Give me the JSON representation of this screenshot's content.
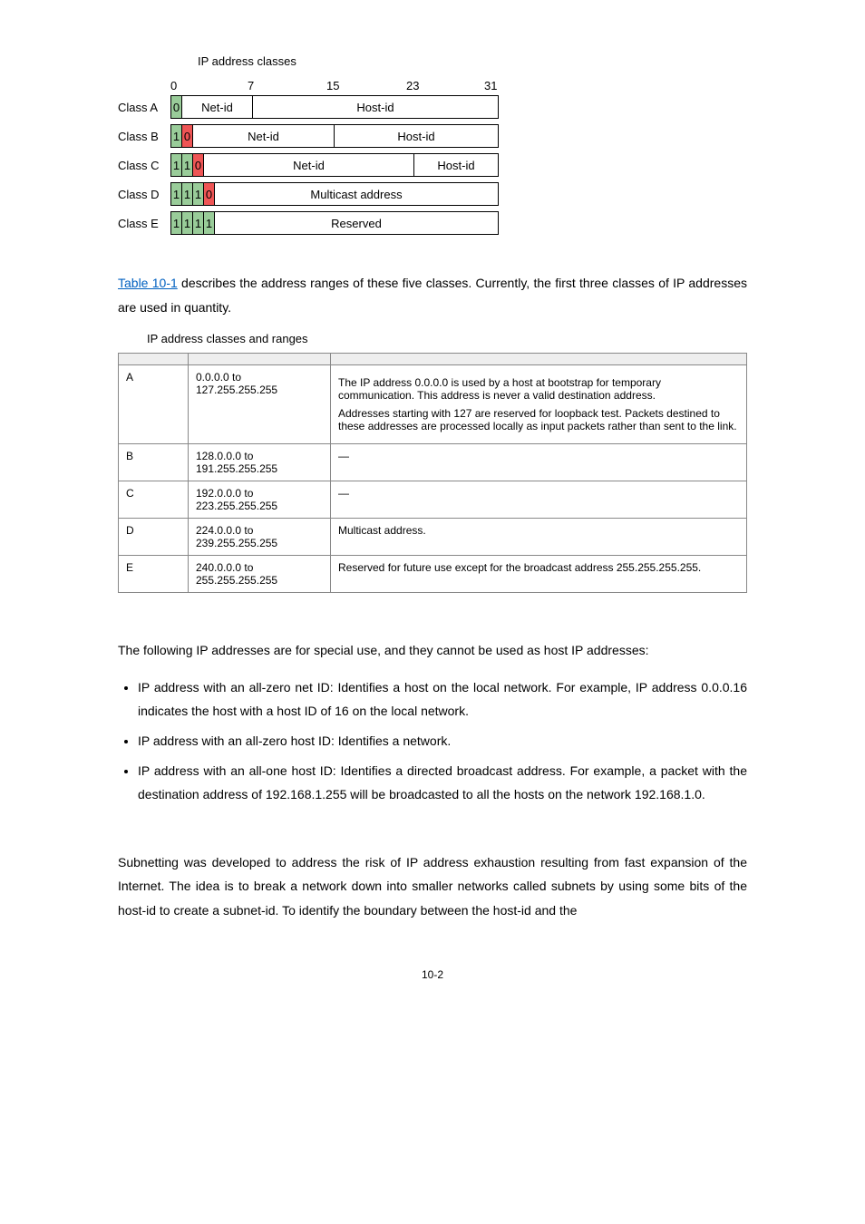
{
  "figure": {
    "caption": "IP address classes",
    "ticks": [
      "0",
      "7",
      "15",
      "23",
      "31"
    ],
    "classA": {
      "label": "Class A",
      "bits": [
        "0"
      ],
      "cells": [
        "Net-id",
        "Host-id"
      ]
    },
    "classB": {
      "label": "Class B",
      "bits": [
        "1",
        "0"
      ],
      "cells": [
        "Net-id",
        "Host-id"
      ]
    },
    "classC": {
      "label": "Class C",
      "bits": [
        "1",
        "1",
        "0"
      ],
      "cells": [
        "Net-id",
        "Host-id"
      ]
    },
    "classD": {
      "label": "Class D",
      "bits": [
        "1",
        "1",
        "1",
        "0"
      ],
      "cells": [
        "Multicast address"
      ]
    },
    "classE": {
      "label": "Class E",
      "bits": [
        "1",
        "1",
        "1",
        "1"
      ],
      "cells": [
        "Reserved"
      ]
    }
  },
  "para1_pre": "Table 10-1",
  "para1_post": " describes the address ranges of these five classes. Currently, the first three classes of IP addresses are used in quantity.",
  "table": {
    "caption": "IP address classes and ranges",
    "rows": [
      {
        "cls": "A",
        "range": "0.0.0.0 to 127.255.255.255",
        "desc1": "The IP address 0.0.0.0 is used by a host at bootstrap for temporary communication. This address is never a valid destination address.",
        "desc2": "Addresses starting with 127 are reserved for loopback test. Packets destined to these addresses are processed locally as input packets rather than sent to the link."
      },
      {
        "cls": "B",
        "range": "128.0.0.0 to 191.255.255.255",
        "desc1": "—",
        "desc2": ""
      },
      {
        "cls": "C",
        "range": "192.0.0.0 to 223.255.255.255",
        "desc1": "—",
        "desc2": ""
      },
      {
        "cls": "D",
        "range": "224.0.0.0 to 239.255.255.255",
        "desc1": "Multicast address.",
        "desc2": ""
      },
      {
        "cls": "E",
        "range": "240.0.0.0 to 255.255.255.255",
        "desc1": "Reserved for future use except for the broadcast address 255.255.255.255.",
        "desc2": ""
      }
    ]
  },
  "para2": "The following IP addresses are for special use, and they cannot be used as host IP addresses:",
  "bullets": [
    "IP address with an all-zero net ID: Identifies a host on the local network. For example, IP address 0.0.0.16 indicates the host with a host ID of 16 on the local network.",
    "IP address with an all-zero host ID: Identifies a network.",
    "IP address with an all-one host ID: Identifies a directed broadcast address. For example, a packet with the destination address of 192.168.1.255 will be broadcasted to all the hosts on the network 192.168.1.0."
  ],
  "para3": "Subnetting was developed to address the risk of IP address exhaustion resulting from fast expansion of the Internet. The idea is to break a network down into smaller networks called subnets by using some bits of the host-id to create a subnet-id. To identify the boundary between the host-id and the",
  "pagenum": "10-2"
}
